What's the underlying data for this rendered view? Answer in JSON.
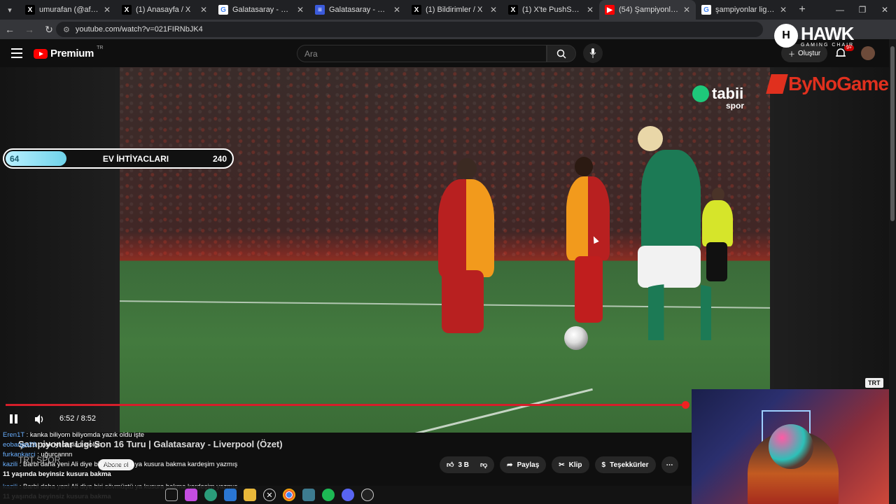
{
  "browser": {
    "tabs": [
      {
        "title": "umurafan (@afanumur) /",
        "icon": "x-logo",
        "active": false
      },
      {
        "title": "(1) Anasayfa / X",
        "icon": "x-logo",
        "active": false
      },
      {
        "title": "Galatasaray - Google'da /",
        "icon": "google-logo",
        "active": false
      },
      {
        "title": "Galatasaray - Liverpool ca",
        "icon": "news-icon",
        "active": false
      },
      {
        "title": "(1) Bildirimler / X",
        "icon": "x-logo",
        "active": false
      },
      {
        "title": "(1) X'te PushSpor: \"Arne S",
        "icon": "x-logo",
        "active": false
      },
      {
        "title": "(54) Şampiyonlar Ligi",
        "icon": "youtube-logo",
        "active": true
      },
      {
        "title": "şampiyonlar ligi - Google",
        "icon": "google-logo",
        "active": false
      }
    ],
    "url": "youtube.com/watch?v=021FIRNbJK4"
  },
  "youtube": {
    "logo_text": "Premium",
    "logo_region": "TR",
    "search_placeholder": "Ara",
    "create_label": "Oluştur",
    "notification_count": "9+"
  },
  "overlays": {
    "hawk_brand": "HAWK",
    "hawk_sub": "GAMING CHAIR",
    "bynogame": "ByNoGame",
    "tabii_text": "tabii",
    "tabii_sub": "spor",
    "trt_badge": "TRT"
  },
  "goal_bar": {
    "current": "64",
    "label": "EV İHTİYACLARI",
    "target": "240",
    "progress": 0.267
  },
  "player": {
    "time": "6:52 / 8:52",
    "progress": 0.774
  },
  "video_info": {
    "title": "Şampiyonlar Ligi Son 16 Turu | Galatasaray - Liverpool (Özet)",
    "channel": "TRT SPOR",
    "subscribe_label": "Abone ol"
  },
  "actions": {
    "like_count": "3 B",
    "share_label": "Paylaş",
    "clip_label": "Klip",
    "thanks_label": "Teşekkürler"
  },
  "chat": [
    {
      "user": "Eren1T",
      "message": "kanka biliyom biliyomda yazık oldu işte"
    },
    {
      "user": "eobanga23",
      "message": "çok iyi başladı oolgn"
    },
    {
      "user": "furkankarci",
      "message": "uğurcannn"
    },
    {
      "user": "kazili",
      "message": "Barbi daha yeni Ali diye biri sövmüştü ya kusura bakma kardeşim yazmış"
    },
    {
      "user": "",
      "message": "11 yaşında beyinsiz kusura bakma"
    },
    {
      "user": "kazili",
      "message": "Barbi daha yeni Ali diye biri sövmüştü ya kusura bakma kardeşim yazmış"
    },
    {
      "user": "",
      "message": "11 yaşında beyinsiz kusura bakma"
    }
  ],
  "colors": {
    "accent_red": "#ff0000",
    "goal_fill": "#6fd3ea",
    "chat_user": "#6ab0ff"
  }
}
